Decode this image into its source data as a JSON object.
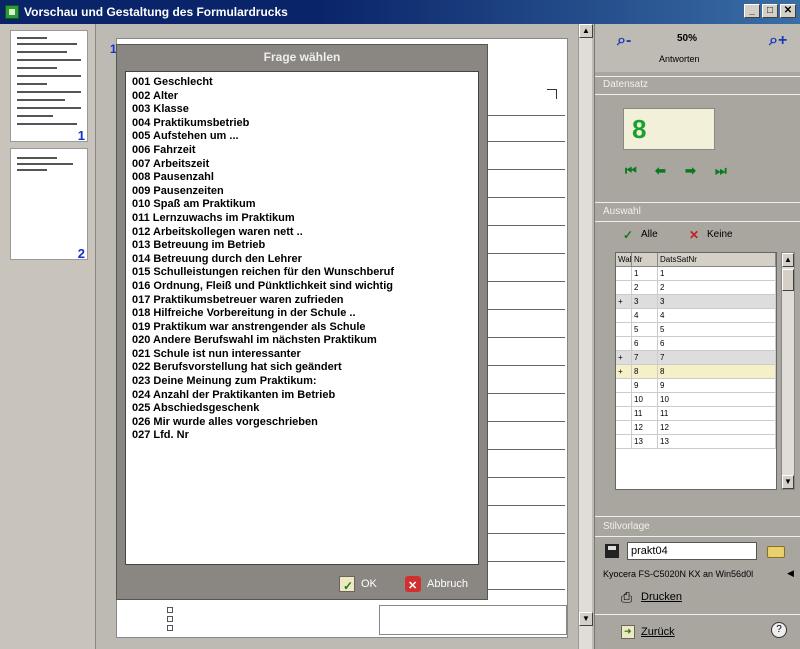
{
  "window": {
    "title": "Vorschau und Gestaltung des Formulardrucks",
    "buttons": [
      "_",
      "□",
      "✕"
    ]
  },
  "thumbnails": [
    {
      "number": "1"
    },
    {
      "number": "2"
    }
  ],
  "document": {
    "page_number": "1"
  },
  "dialog": {
    "title": "Frage wählen",
    "items": [
      "001 Geschlecht",
      "002 Alter",
      "003 Klasse",
      "004 Praktikumsbetrieb",
      "005 Aufstehen um ...",
      "006 Fahrzeit",
      "007 Arbeitszeit",
      "008 Pausenzahl",
      "009 Pausenzeiten",
      "010 Spaß am Praktikum",
      "011 Lernzuwachs im Praktikum",
      "012 Arbeitskollegen waren nett ..",
      "013 Betreuung im Betrieb",
      "014 Betreuung durch den Lehrer",
      "015 Schulleistungen reichen für den Wunschberuf",
      "016 Ordnung, Fleiß und Pünktlichkeit sind wichtig",
      "017 Praktikumsbetreuer waren zufrieden",
      "018 Hilfreiche Vorbereitung in der Schule ..",
      "019 Praktikum war anstrengender als Schule",
      "020 Andere Berufswahl im nächsten Praktikum",
      "021 Schule ist nun interessanter",
      "022 Berufsvorstellung hat sich geändert",
      "023 Deine Meinung zum Praktikum:",
      "024 Anzahl der Praktikanten im Betrieb",
      "025 Abschiedsgeschenk",
      "026 Mir wurde alles vorgeschrieben",
      "027 Lfd. Nr"
    ],
    "ok_label": "OK",
    "cancel_label": "Abbruch"
  },
  "panel": {
    "zoom_value": "50%",
    "zoom_label": "Antworten",
    "datensatz_label": "Datensatz",
    "record_number": "8",
    "auswahl_label": "Auswahl",
    "alle_label": "Alle",
    "keine_label": "Keine",
    "grid_headers": [
      "Wal",
      "Nr",
      "DatsSatNr"
    ],
    "grid_rows": [
      {
        "mark": "",
        "nr": "1",
        "ds": "1",
        "alt": false
      },
      {
        "mark": "",
        "nr": "2",
        "ds": "2",
        "alt": false
      },
      {
        "mark": "+",
        "nr": "3",
        "ds": "3",
        "alt": true
      },
      {
        "mark": "",
        "nr": "4",
        "ds": "4",
        "alt": false
      },
      {
        "mark": "",
        "nr": "5",
        "ds": "5",
        "alt": false
      },
      {
        "mark": "",
        "nr": "6",
        "ds": "6",
        "alt": false
      },
      {
        "mark": "+",
        "nr": "7",
        "ds": "7",
        "alt": true
      },
      {
        "mark": "+",
        "nr": "8",
        "ds": "8",
        "alt": false,
        "current": true
      },
      {
        "mark": "",
        "nr": "9",
        "ds": "9",
        "alt": false
      },
      {
        "mark": "",
        "nr": "10",
        "ds": "10",
        "alt": false
      },
      {
        "mark": "",
        "nr": "11",
        "ds": "11",
        "alt": false
      },
      {
        "mark": "",
        "nr": "12",
        "ds": "12",
        "alt": false
      },
      {
        "mark": "",
        "nr": "13",
        "ds": "13",
        "alt": false
      }
    ],
    "stilvorlage_label": "Stilvorlage",
    "style_value": "prakt04",
    "printer": "Kyocera FS-C5020N KX an Win56d0l",
    "print_label": "Drucken",
    "back_label": "Zurück",
    "help_glyph": "?"
  }
}
